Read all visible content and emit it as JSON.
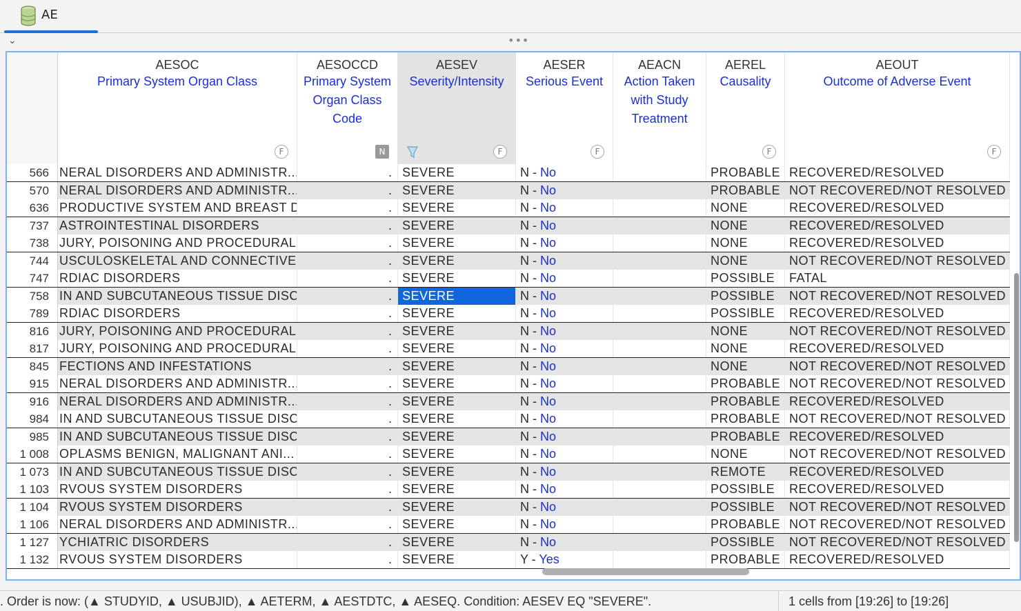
{
  "tab": {
    "label": "AE",
    "icon": "database-icon"
  },
  "columns": [
    {
      "key": "aesoc",
      "name": "AESOC",
      "label": "Primary System Organ Class",
      "badge": "F"
    },
    {
      "key": "aesoccd",
      "name": "AESOCCD",
      "label": "Primary System Organ Class Code",
      "badge": "N"
    },
    {
      "key": "aesev",
      "name": "AESEV",
      "label": "Severity/Intensity",
      "badge": "F"
    },
    {
      "key": "aeser",
      "name": "AESER",
      "label": "Serious Event",
      "badge": "F"
    },
    {
      "key": "aeacn",
      "name": "AEACN",
      "label": "Action Taken with Study Treatment",
      "badge": ""
    },
    {
      "key": "aerel",
      "name": "AEREL",
      "label": "Causality",
      "badge": "F"
    },
    {
      "key": "aeout",
      "name": "AEOUT",
      "label": "Outcome of Adverse Event",
      "badge": "F"
    }
  ],
  "rows": [
    {
      "n": "566",
      "aesoc": "NERAL DISORDERS AND ADMINISTR...",
      "aesoccd": ".",
      "aesev": "SEVERE",
      "aeser_code": "N - ",
      "aeser_text": "No",
      "aeacn": "",
      "aerel": "PROBABLE",
      "aeout": "RECOVERED/RESOLVED"
    },
    {
      "n": "570",
      "aesoc": "NERAL DISORDERS AND ADMINISTR...",
      "aesoccd": ".",
      "aesev": "SEVERE",
      "aeser_code": "N - ",
      "aeser_text": "No",
      "aeacn": "",
      "aerel": "PROBABLE",
      "aeout": "NOT RECOVERED/NOT RESOLVED"
    },
    {
      "n": "636",
      "aesoc": "PRODUCTIVE SYSTEM AND BREAST D...",
      "aesoccd": ".",
      "aesev": "SEVERE",
      "aeser_code": "N - ",
      "aeser_text": "No",
      "aeacn": "",
      "aerel": "NONE",
      "aeout": "RECOVERED/RESOLVED"
    },
    {
      "n": "737",
      "aesoc": "ASTROINTESTINAL DISORDERS",
      "aesoccd": ".",
      "aesev": "SEVERE",
      "aeser_code": "N - ",
      "aeser_text": "No",
      "aeacn": "",
      "aerel": "NONE",
      "aeout": "RECOVERED/RESOLVED"
    },
    {
      "n": "738",
      "aesoc": "JURY, POISONING AND PROCEDURAL...",
      "aesoccd": ".",
      "aesev": "SEVERE",
      "aeser_code": "N - ",
      "aeser_text": "No",
      "aeacn": "",
      "aerel": "NONE",
      "aeout": "RECOVERED/RESOLVED"
    },
    {
      "n": "744",
      "aesoc": "USCULOSKELETAL AND CONNECTIVE...",
      "aesoccd": ".",
      "aesev": "SEVERE",
      "aeser_code": "N - ",
      "aeser_text": "No",
      "aeacn": "",
      "aerel": "NONE",
      "aeout": "NOT RECOVERED/NOT RESOLVED"
    },
    {
      "n": "747",
      "aesoc": "RDIAC DISORDERS",
      "aesoccd": ".",
      "aesev": "SEVERE",
      "aeser_code": "N - ",
      "aeser_text": "No",
      "aeacn": "",
      "aerel": "POSSIBLE",
      "aeout": "FATAL"
    },
    {
      "n": "758",
      "aesoc": "IN AND SUBCUTANEOUS TISSUE DISC...",
      "aesoccd": ".",
      "aesev": "SEVERE",
      "aeser_code": "N - ",
      "aeser_text": "No",
      "aeacn": "",
      "aerel": "POSSIBLE",
      "aeout": "NOT RECOVERED/NOT RESOLVED",
      "selected": true
    },
    {
      "n": "789",
      "aesoc": "RDIAC DISORDERS",
      "aesoccd": ".",
      "aesev": "SEVERE",
      "aeser_code": "N - ",
      "aeser_text": "No",
      "aeacn": "",
      "aerel": "POSSIBLE",
      "aeout": "RECOVERED/RESOLVED"
    },
    {
      "n": "816",
      "aesoc": "JURY, POISONING AND PROCEDURAL...",
      "aesoccd": ".",
      "aesev": "SEVERE",
      "aeser_code": "N - ",
      "aeser_text": "No",
      "aeacn": "",
      "aerel": "NONE",
      "aeout": "NOT RECOVERED/NOT RESOLVED"
    },
    {
      "n": "817",
      "aesoc": "JURY, POISONING AND PROCEDURAL...",
      "aesoccd": ".",
      "aesev": "SEVERE",
      "aeser_code": "N - ",
      "aeser_text": "No",
      "aeacn": "",
      "aerel": "NONE",
      "aeout": "RECOVERED/RESOLVED"
    },
    {
      "n": "845",
      "aesoc": "FECTIONS AND INFESTATIONS",
      "aesoccd": ".",
      "aesev": "SEVERE",
      "aeser_code": "N - ",
      "aeser_text": "No",
      "aeacn": "",
      "aerel": "NONE",
      "aeout": "NOT RECOVERED/NOT RESOLVED"
    },
    {
      "n": "915",
      "aesoc": "NERAL DISORDERS AND ADMINISTR...",
      "aesoccd": ".",
      "aesev": "SEVERE",
      "aeser_code": "N - ",
      "aeser_text": "No",
      "aeacn": "",
      "aerel": "PROBABLE",
      "aeout": "NOT RECOVERED/NOT RESOLVED"
    },
    {
      "n": "916",
      "aesoc": "NERAL DISORDERS AND ADMINISTR...",
      "aesoccd": ".",
      "aesev": "SEVERE",
      "aeser_code": "N - ",
      "aeser_text": "No",
      "aeacn": "",
      "aerel": "PROBABLE",
      "aeout": "RECOVERED/RESOLVED"
    },
    {
      "n": "984",
      "aesoc": "IN AND SUBCUTANEOUS TISSUE DISC...",
      "aesoccd": ".",
      "aesev": "SEVERE",
      "aeser_code": "N - ",
      "aeser_text": "No",
      "aeacn": "",
      "aerel": "PROBABLE",
      "aeout": "NOT RECOVERED/NOT RESOLVED"
    },
    {
      "n": "985",
      "aesoc": "IN AND SUBCUTANEOUS TISSUE DISC...",
      "aesoccd": ".",
      "aesev": "SEVERE",
      "aeser_code": "N - ",
      "aeser_text": "No",
      "aeacn": "",
      "aerel": "PROBABLE",
      "aeout": "RECOVERED/RESOLVED"
    },
    {
      "n": "1 008",
      "aesoc": "OPLASMS BENIGN, MALIGNANT ANI...",
      "aesoccd": ".",
      "aesev": "SEVERE",
      "aeser_code": "N - ",
      "aeser_text": "No",
      "aeacn": "",
      "aerel": "NONE",
      "aeout": "NOT RECOVERED/NOT RESOLVED"
    },
    {
      "n": "1 073",
      "aesoc": "IN AND SUBCUTANEOUS TISSUE DISC...",
      "aesoccd": ".",
      "aesev": "SEVERE",
      "aeser_code": "N - ",
      "aeser_text": "No",
      "aeacn": "",
      "aerel": "REMOTE",
      "aeout": "RECOVERED/RESOLVED"
    },
    {
      "n": "1 103",
      "aesoc": "RVOUS SYSTEM DISORDERS",
      "aesoccd": ".",
      "aesev": "SEVERE",
      "aeser_code": "N - ",
      "aeser_text": "No",
      "aeacn": "",
      "aerel": "POSSIBLE",
      "aeout": "RECOVERED/RESOLVED"
    },
    {
      "n": "1 104",
      "aesoc": "RVOUS SYSTEM DISORDERS",
      "aesoccd": ".",
      "aesev": "SEVERE",
      "aeser_code": "N - ",
      "aeser_text": "No",
      "aeacn": "",
      "aerel": "POSSIBLE",
      "aeout": "NOT RECOVERED/NOT RESOLVED"
    },
    {
      "n": "1 106",
      "aesoc": "NERAL DISORDERS AND ADMINISTR...",
      "aesoccd": ".",
      "aesev": "SEVERE",
      "aeser_code": "N - ",
      "aeser_text": "No",
      "aeacn": "",
      "aerel": "PROBABLE",
      "aeout": "NOT RECOVERED/NOT RESOLVED"
    },
    {
      "n": "1 127",
      "aesoc": "YCHIATRIC DISORDERS",
      "aesoccd": ".",
      "aesev": "SEVERE",
      "aeser_code": "N - ",
      "aeser_text": "No",
      "aeacn": "",
      "aerel": "POSSIBLE",
      "aeout": "NOT RECOVERED/NOT RESOLVED"
    },
    {
      "n": "1 132",
      "aesoc": "RVOUS SYSTEM DISORDERS",
      "aesoccd": ".",
      "aesev": "SEVERE",
      "aeser_code": "Y - ",
      "aeser_text": "Yes",
      "aeacn": "",
      "aerel": "PROBABLE",
      "aeout": "RECOVERED/RESOLVED"
    }
  ],
  "status": {
    "left": ". Order is now: (▲ STUDYID, ▲ USUBJID), ▲ AETERM, ▲ AESTDTC, ▲ AESEQ. Condition: AESEV EQ \"SEVERE\".",
    "right": "1 cells from [19:26] to [19:26]"
  },
  "colors": {
    "accent": "#1f6fd6",
    "label": "#1a2fd6",
    "selection": "#1166dd",
    "alt_row": "#e4e4e4"
  }
}
